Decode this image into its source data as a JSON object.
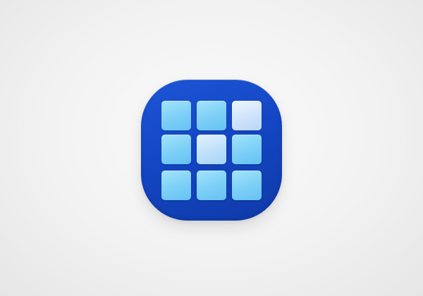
{
  "app_icon": {
    "icon": "grid-icon",
    "grid": {
      "rows": 3,
      "columns": 3
    },
    "colors": {
      "background": "#f2f2f2",
      "icon_base": "#1446c4",
      "tile_cyan": "#7ccff6",
      "tile_pale": "#cfe3fb"
    }
  }
}
